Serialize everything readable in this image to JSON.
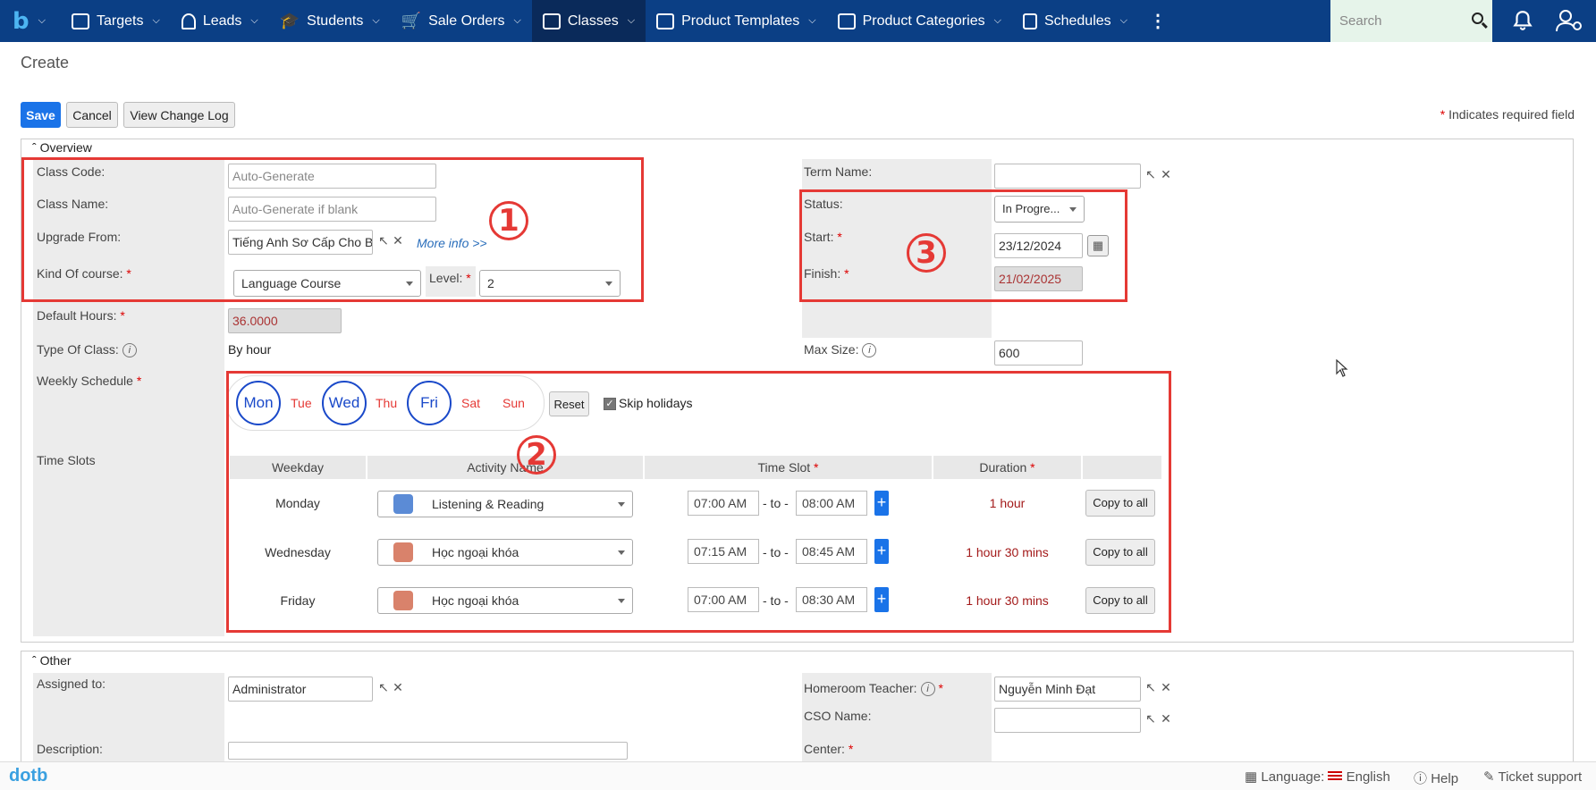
{
  "nav": {
    "items": [
      {
        "label": "Targets",
        "icon": "targets-icon"
      },
      {
        "label": "Leads",
        "icon": "leads-icon"
      },
      {
        "label": "Students",
        "icon": "students-icon"
      },
      {
        "label": "Sale Orders",
        "icon": "cart-icon"
      },
      {
        "label": "Classes",
        "icon": "classes-icon",
        "active": true
      },
      {
        "label": "Product Templates",
        "icon": "product-templates-icon"
      },
      {
        "label": "Product Categories",
        "icon": "product-categories-icon"
      },
      {
        "label": "Schedules",
        "icon": "calendar-icon"
      }
    ],
    "search_placeholder": "Search"
  },
  "page": {
    "title": "Create"
  },
  "toolbar": {
    "save": "Save",
    "cancel": "Cancel",
    "change_log": "View Change Log",
    "required_note": "Indicates required field"
  },
  "overview": {
    "title": "Overview",
    "class_code": {
      "label": "Class Code:",
      "placeholder": "Auto-Generate"
    },
    "class_name": {
      "label": "Class Name:",
      "placeholder": "Auto-Generate if blank"
    },
    "upgrade_from": {
      "label": "Upgrade From:",
      "value": "Tiếng Anh Sơ Cấp Cho B",
      "more": "More info >>"
    },
    "kind_of_course": {
      "label": "Kind Of course:",
      "value": "Language Course"
    },
    "level": {
      "label": "Level:",
      "value": "2"
    },
    "default_hours": {
      "label": "Default Hours:",
      "value": "36.0000"
    },
    "type_of_class": {
      "label": "Type Of Class:",
      "value": "By hour"
    },
    "weekly_schedule": {
      "label": "Weekly Schedule"
    },
    "time_slots": {
      "label": "Time Slots"
    },
    "term_name": {
      "label": "Term Name:",
      "value": ""
    },
    "status": {
      "label": "Status:",
      "value": "In Progre..."
    },
    "start": {
      "label": "Start:",
      "value": "23/12/2024"
    },
    "finish": {
      "label": "Finish:",
      "value": "21/02/2025"
    },
    "max_size": {
      "label": "Max Size:",
      "value": "600"
    }
  },
  "days": [
    {
      "label": "Mon",
      "on": true
    },
    {
      "label": "Tue",
      "on": false
    },
    {
      "label": "Wed",
      "on": true
    },
    {
      "label": "Thu",
      "on": false
    },
    {
      "label": "Fri",
      "on": true
    },
    {
      "label": "Sat",
      "on": false
    },
    {
      "label": "Sun",
      "on": false
    }
  ],
  "schedule_controls": {
    "reset": "Reset",
    "skip_holidays": "Skip holidays",
    "skip_checked": true
  },
  "slots_table": {
    "headers": [
      "Weekday",
      "Activity Name",
      "Time Slot",
      "Duration"
    ],
    "to": "- to -",
    "copy": "Copy to all",
    "rows": [
      {
        "weekday": "Monday",
        "activity": "Listening & Reading",
        "from": "07:00 AM",
        "to": "08:00 AM",
        "duration": "1 hour"
      },
      {
        "weekday": "Wednesday",
        "activity": "Học ngoại khóa",
        "from": "07:15 AM",
        "to": "08:45 AM",
        "duration": "1 hour 30 mins"
      },
      {
        "weekday": "Friday",
        "activity": "Học ngoại khóa",
        "from": "07:00 AM",
        "to": "08:30 AM",
        "duration": "1 hour 30 mins"
      }
    ]
  },
  "annotations": [
    "1",
    "2",
    "3"
  ],
  "other": {
    "title": "Other",
    "assigned_to": {
      "label": "Assigned to:",
      "value": "Administrator"
    },
    "description": {
      "label": "Description:"
    },
    "homeroom": {
      "label": "Homeroom Teacher:",
      "value": "Nguyễn Minh Đạt"
    },
    "cso": {
      "label": "CSO Name:",
      "value": ""
    },
    "center": {
      "label": "Center:"
    }
  },
  "footer": {
    "logo": "dotb",
    "language_label": "Language:",
    "language": "English",
    "help": "Help",
    "ticket": "Ticket support"
  }
}
